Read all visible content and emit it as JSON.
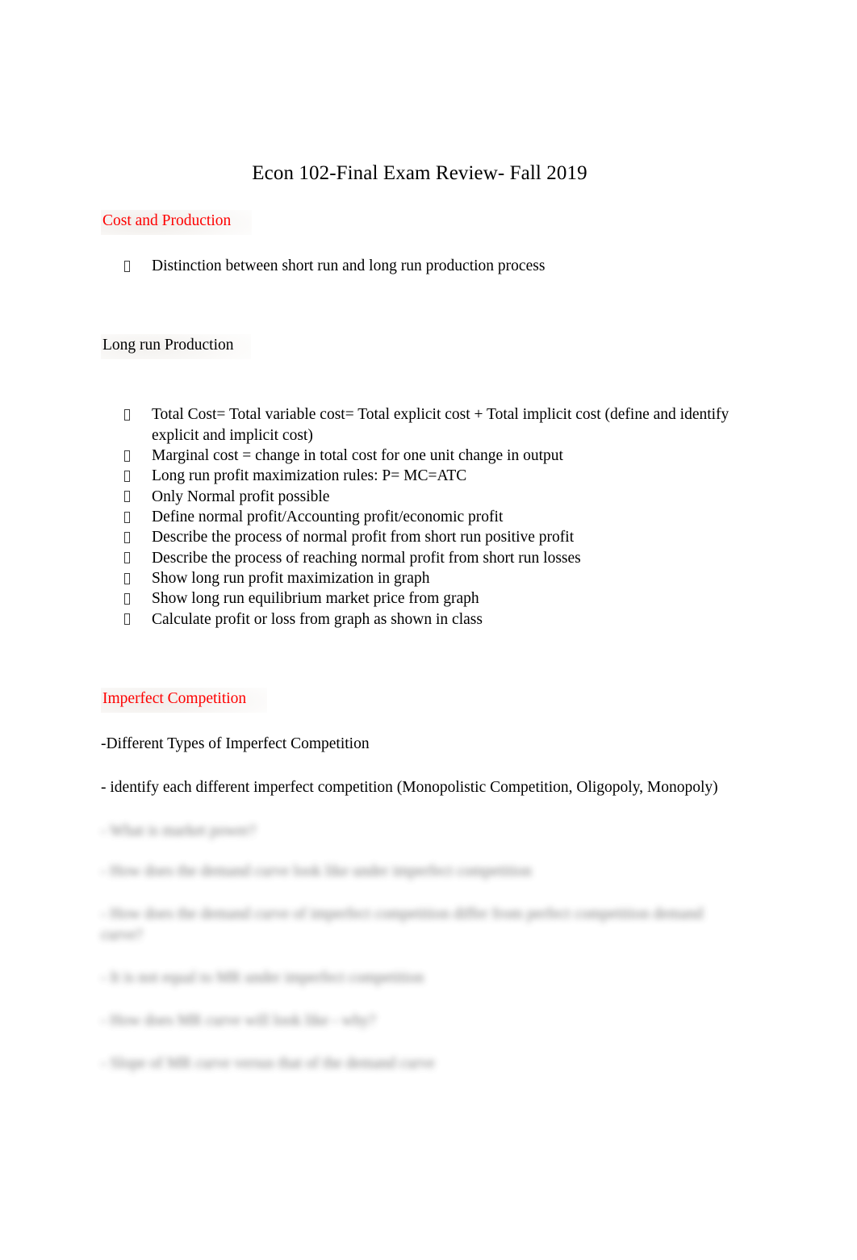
{
  "document": {
    "title": "Econ 102-Final Exam Review- Fall 2019",
    "accent_color": "#fe0000",
    "text_color": "#000000",
    "background_color": "#ffffff",
    "bullet_glyph": "missing-glyph-box"
  },
  "sections": [
    {
      "heading": "Cost and Production",
      "bullets": [
        "Distinction between short run and long run production process"
      ]
    },
    {
      "subheading": "Long run Production",
      "bullets": [
        "Total Cost= Total variable cost= Total explicit cost + Total implicit cost (define and identify explicit and implicit cost)",
        "Marginal cost = change in total cost for one unit change in output",
        "Long run profit maximization rules: P= MC=ATC",
        "Only Normal profit possible",
        "Define normal profit/Accounting profit/economic profit",
        "Describe the process of normal profit from short run positive profit",
        "Describe the process of reaching normal profit from short run losses",
        "Show long run profit maximization in graph",
        "Show long run equilibrium market price from graph",
        "Calculate profit or loss from graph as shown in class"
      ]
    },
    {
      "heading": "Imperfect Competition",
      "paragraphs": [
        "-Different Types of Imperfect Competition",
        "- identify each different imperfect competition (Monopolistic Competition, Oligopoly, Monopoly)"
      ]
    }
  ],
  "redacted": {
    "note": "blurred-illegible",
    "lines": [
      "- What is market power?",
      "- How does the demand curve look like under imperfect competition",
      "- How does the demand curve of imperfect competition differ from perfect competition demand curve?",
      "- It is not equal to MR under imperfect competition",
      "- How does MR curve will look like - why?",
      "- Slope of MR curve versus that of the demand curve"
    ]
  }
}
